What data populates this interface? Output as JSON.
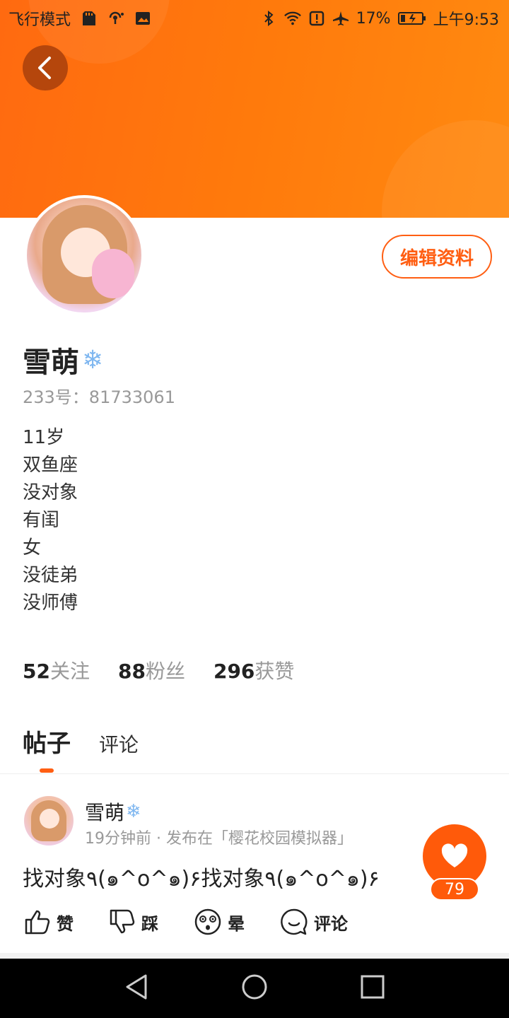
{
  "status_bar": {
    "airplane_mode_label": "飞行模式",
    "battery_percent": "17%",
    "time": "上午9:53",
    "icons": [
      "sd-card-icon",
      "hotspot-icon",
      "image-icon",
      "bluetooth-icon",
      "wifi-icon",
      "alert-icon",
      "airplane-icon",
      "battery-charging-icon"
    ]
  },
  "colors": {
    "accent": "#ff5e12",
    "header_start": "#ff6a10",
    "header_end": "#ff8a10"
  },
  "profile": {
    "name": "雪萌",
    "name_badge_icon": "snowflake-icon",
    "uid": "233号：81733061",
    "edit_button_label": "编辑资料",
    "bio": [
      "11岁",
      "双鱼座",
      "没对象",
      "有闺",
      "女",
      "没徒弟",
      "没师傅"
    ]
  },
  "stats": [
    {
      "value": "52",
      "label": "关注"
    },
    {
      "value": "88",
      "label": "粉丝"
    },
    {
      "value": "296",
      "label": "获赞"
    }
  ],
  "tabs": [
    {
      "label": "帖子",
      "active": true
    },
    {
      "label": "评论",
      "active": false
    }
  ],
  "post": {
    "author": "雪萌",
    "meta": "19分钟前 · 发布在「樱花校园模拟器」",
    "text": "找对象٩(๑^o^๑)۶找对象٩(๑^o^๑)۶",
    "like_count": "79",
    "actions": [
      {
        "label": "赞",
        "icon": "thumbs-up-icon"
      },
      {
        "label": "踩",
        "icon": "thumbs-down-icon"
      },
      {
        "label": "晕",
        "icon": "dizzy-face-icon"
      },
      {
        "label": "评论",
        "icon": "comment-icon"
      }
    ]
  },
  "nav_bar": {
    "icons": [
      "back-triangle-icon",
      "home-circle-icon",
      "recents-square-icon"
    ]
  }
}
